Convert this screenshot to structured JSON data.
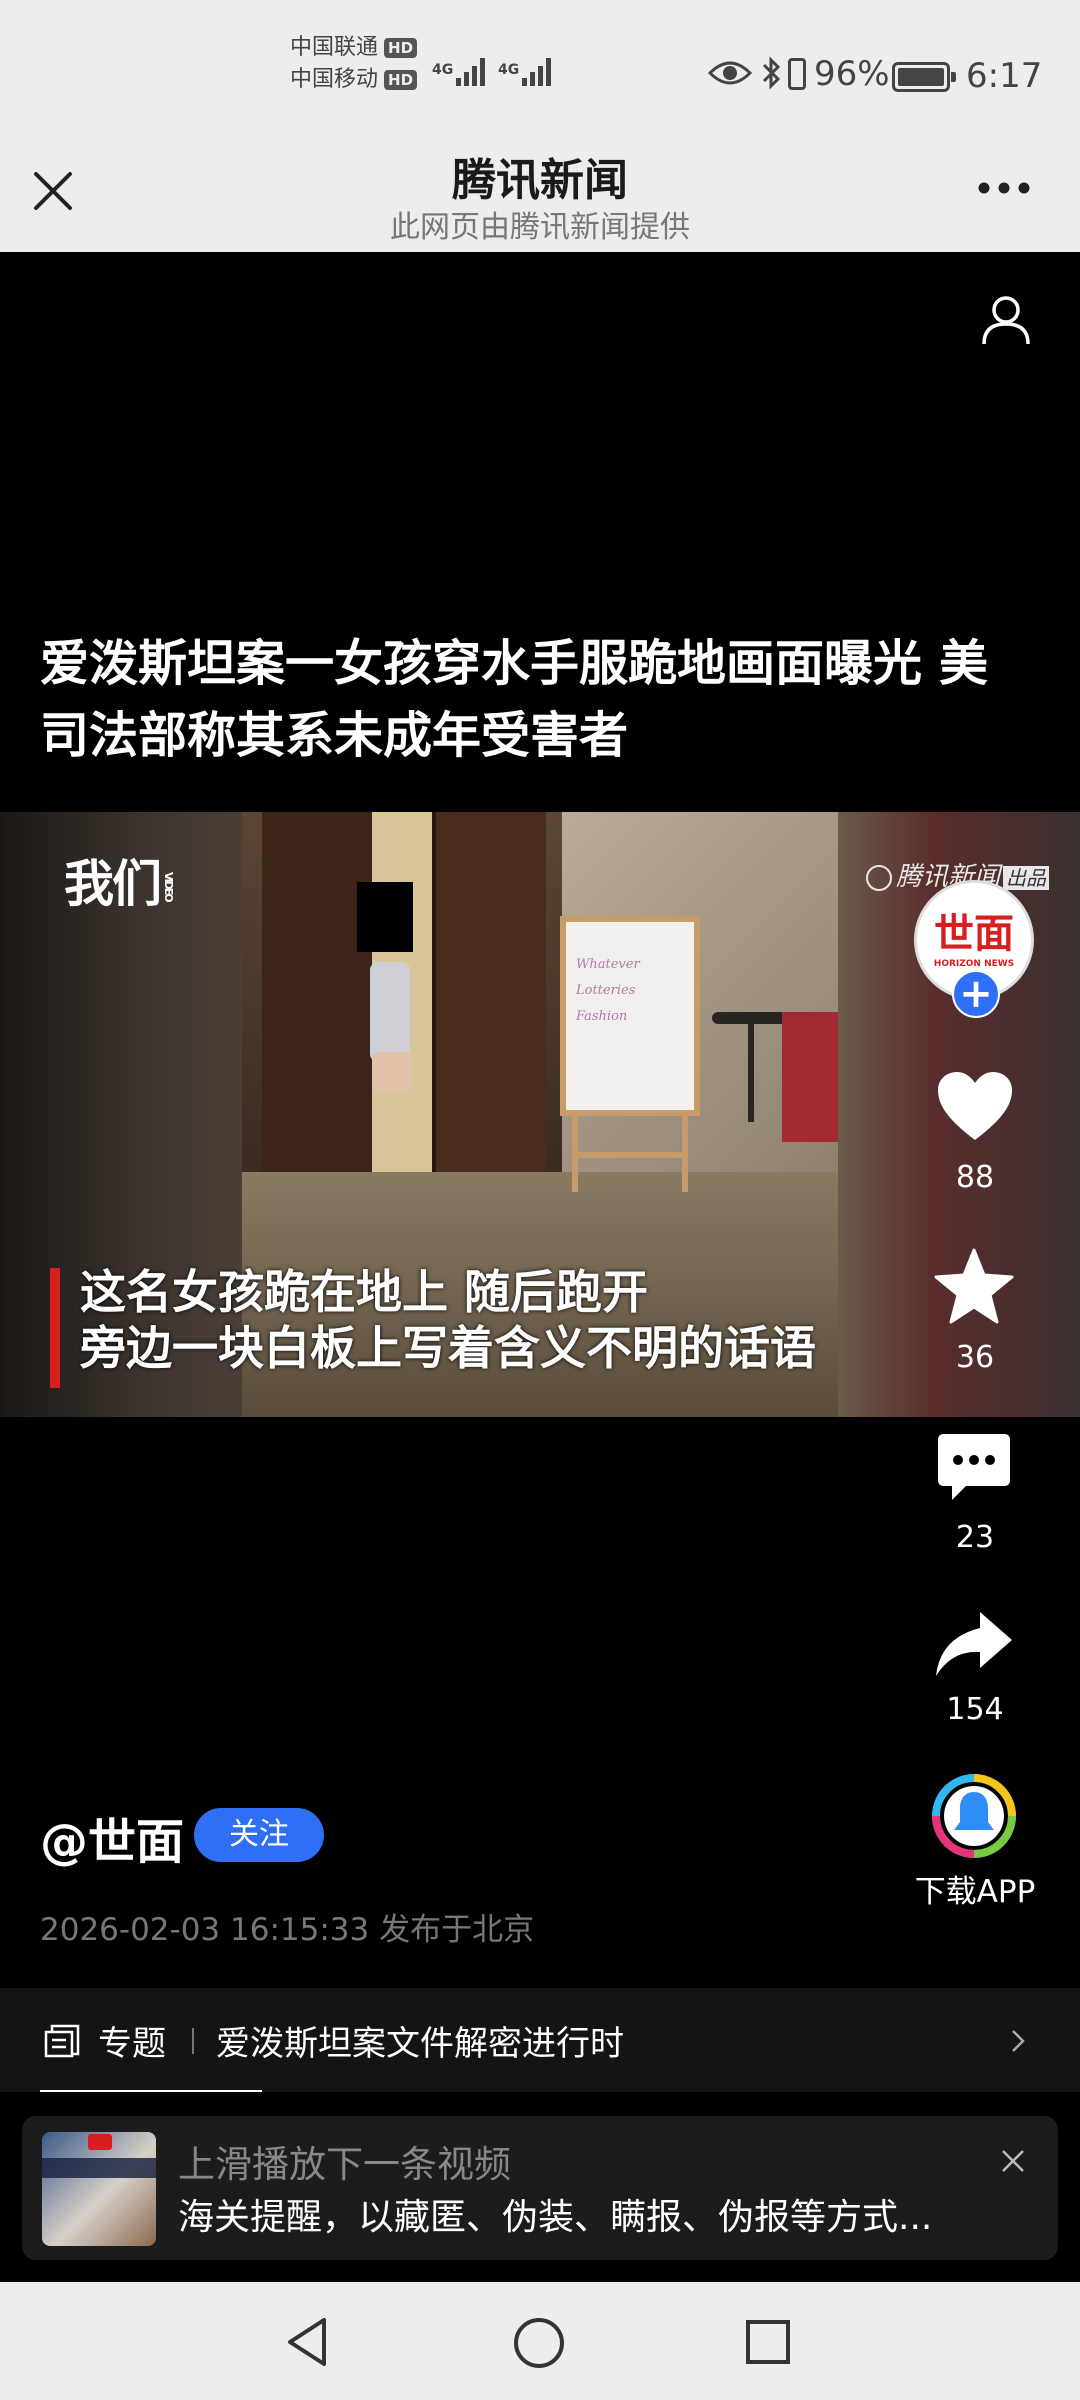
{
  "status_bar": {
    "carrier1": "中国联通",
    "carrier2": "中国移动",
    "hd_badge": "HD",
    "network": "4G",
    "battery_pct": "96%",
    "time": "6:17"
  },
  "nav": {
    "title": "腾讯新闻",
    "subtitle": "此网页由腾讯新闻提供",
    "close_icon": "close-icon",
    "more_icon": "more-dots-icon"
  },
  "article": {
    "headline_line1": "爱泼斯坦案一女孩穿水手服跪地画面曝光 美",
    "headline_line2": "司法部称其系未成年受害者"
  },
  "video": {
    "watermark_left": "我们",
    "watermark_left_small": "VIDEO",
    "watermark_right": "腾讯新闻",
    "watermark_right_badge": "出品",
    "whiteboard_text": [
      "Whatever",
      "Lotteries",
      "Fashion"
    ],
    "caption_line1": "这名女孩跪在地上 随后跑开",
    "caption_line2": "旁边一块白板上写着含义不明的话语"
  },
  "sidebar": {
    "avatar_text": "世面",
    "avatar_sub": "HORIZON NEWS",
    "follow_plus": "+",
    "like_count": "88",
    "favorite_count": "36",
    "comment_count": "23",
    "share_count": "154",
    "download_label": "下载APP"
  },
  "author": {
    "handle": "@世面",
    "follow_label": "关注",
    "timestamp": "2026-02-03 16:15:33 发布于北京"
  },
  "topic": {
    "label": "专题",
    "title": "爱泼斯坦案文件解密进行时"
  },
  "next_video": {
    "hint": "上滑播放下一条视频",
    "title": "海关提醒，以藏匿、伪装、瞒报、伪报等方式..."
  },
  "colors": {
    "accent_blue": "#2f6ff5",
    "status_bg": "#ededed",
    "brand_red": "#d81e1e"
  }
}
